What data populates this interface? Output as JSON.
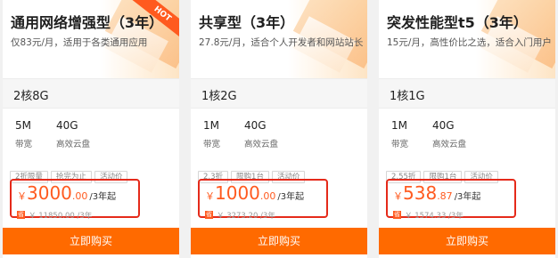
{
  "colors": {
    "accent": "#ff6a00",
    "price": "#ff5a1f",
    "highlight_border": "#e52a1a"
  },
  "cards": [
    {
      "title": "通用网络增强型（3年）",
      "subtitle": "仅83元/月，适用于各类通用应用",
      "badge": "HOT",
      "spec": "2核8G",
      "bandwidth_value": "5M",
      "bandwidth_label": "带宽",
      "disk_value": "40G",
      "disk_label": "高效云盘",
      "tags": [
        "2折限量",
        "抢完为止",
        "活动价"
      ],
      "price_symbol": "￥",
      "price_int": "3000",
      "price_dec": ".00",
      "price_unit": "/3年起",
      "orig_icon": "省",
      "original_price": "￥ 11850.00 /3年",
      "buy_label": "立即购买"
    },
    {
      "title": "共享型（3年）",
      "subtitle": "27.8元/月，适合个人开发者和网站站长",
      "spec": "1核2G",
      "bandwidth_value": "1M",
      "bandwidth_label": "带宽",
      "disk_value": "40G",
      "disk_label": "高效云盘",
      "tags": [
        "2.3折",
        "限购1台",
        "活动价"
      ],
      "price_symbol": "￥",
      "price_int": "1000",
      "price_dec": ".00",
      "price_unit": "/3年起",
      "orig_icon": "省",
      "original_price": "￥ 3273.20 /3年",
      "buy_label": "立即购买"
    },
    {
      "title": "突发性能型t5（3年）",
      "subtitle": "15元/月，高性价比之选，适合入门用户",
      "spec": "1核1G",
      "bandwidth_value": "1M",
      "bandwidth_label": "带宽",
      "disk_value": "40G",
      "disk_label": "高效云盘",
      "tags": [
        "2.55折",
        "限购1台",
        "活动价"
      ],
      "price_symbol": "￥",
      "price_int": "538",
      "price_dec": ".87",
      "price_unit": "/3年起",
      "orig_icon": "省",
      "original_price": "￥ 1574.33 /3年",
      "buy_label": "立即购买"
    }
  ]
}
